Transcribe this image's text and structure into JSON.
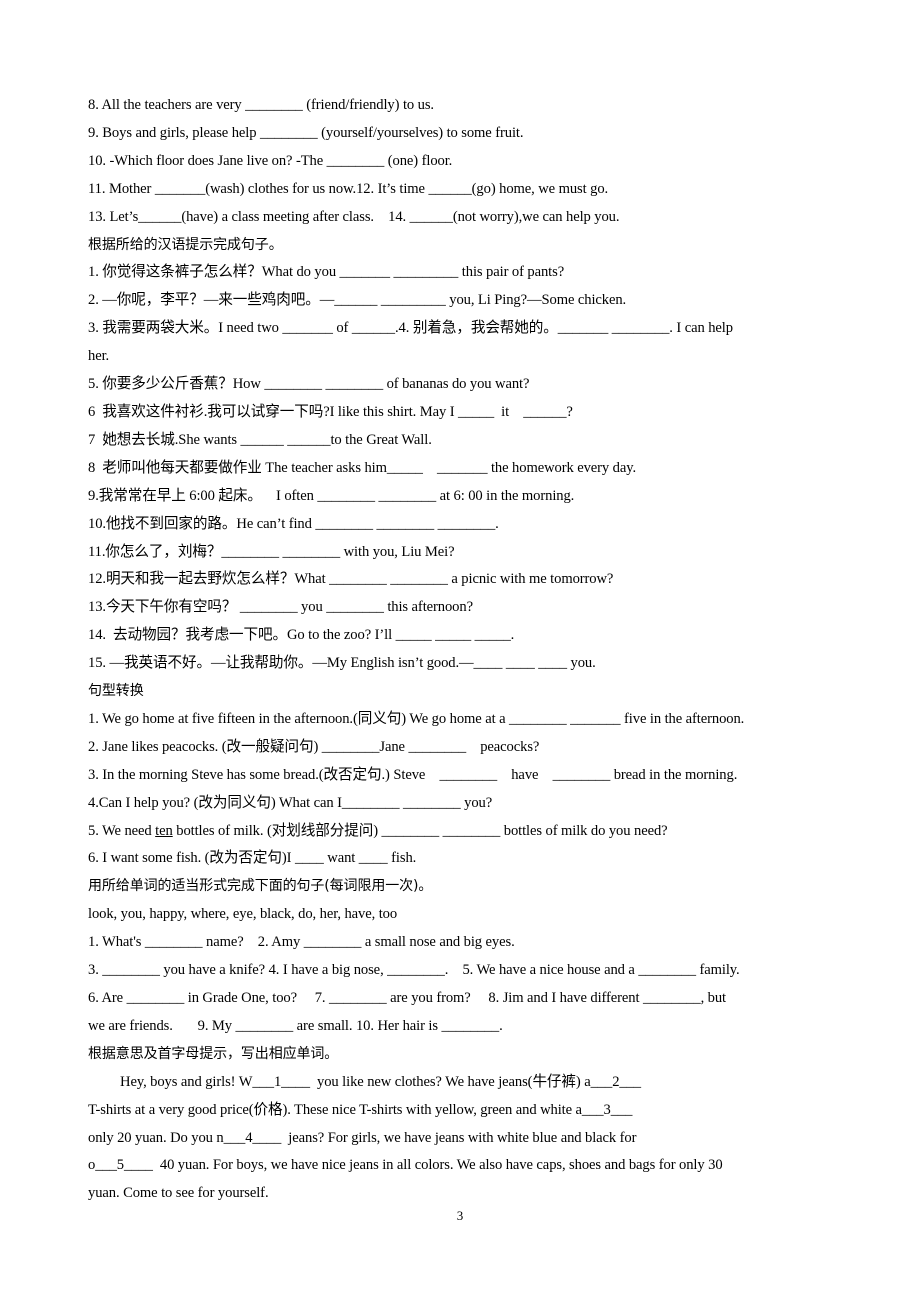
{
  "document": {
    "sections": [
      {
        "id": "fill-brackets-continued",
        "heading": null,
        "lines": [
          "8. All the teachers are very ________ (friend/friendly) to us.",
          "9. Boys and girls, please help ________ (yourself/yourselves) to some fruit.",
          "10. -Which floor does Jane live on? -The ________ (one) floor.",
          "11. Mother _______(wash) clothes for us now.12. It’s time ______(go) home, we must go.",
          "13. Let’s______(have) a class meeting after class.    14. ______(not worry),we can help you."
        ]
      },
      {
        "id": "chinese-hint-sentences",
        "heading": "根据所给的汉语提示完成句子。",
        "lines": [
          "1. 你觉得这条裤子怎么样？What do you _______ _________ this pair of pants?",
          "2. —你呢，李平？—来一些鸡肉吧。—______ _________ you, Li Ping?—Some chicken.",
          "3. 我需要两袋大米。I need two _______ of ______.4. 别着急，我会帮她的。_______ ________. I can help",
          "her.",
          "5. 你要多少公斤香蕉？How ________ ________ of bananas do you want?",
          "6  我喜欢这件衬衫.我可以试穿一下吗?I like this shirt. May I _____  it    ______?",
          "7  她想去长城.She wants ______ ______to the Great Wall.",
          "8  老师叫他每天都要做作业 The teacher asks him_____    _______ the homework every day.",
          "9.我常常在早上 6:00 起床。    I often ________ ________ at 6: 00 in the morning.",
          "10.他找不到回家的路。He can’t find ________ ________ ________.",
          "11.你怎么了，刘梅？________ ________ with you, Liu Mei?",
          "12.明天和我一起去野炊怎么样？What ________ ________ a picnic with me tomorrow?",
          "13.今天下午你有空吗？ ________ you ________ this afternoon?",
          "14.  去动物园？我考虑一下吧。Go to the zoo? I’ll _____ _____ _____.",
          "15. —我英语不好。—让我帮助你。—My English isn’t good.—____ ____ ____ you."
        ]
      },
      {
        "id": "sentence-transformation",
        "heading": "句型转换",
        "lines": [
          "1. We go home at five fifteen in the afternoon.(同义句) We go home at a ________ _______ five in the afternoon.",
          "2. Jane likes peacocks. (改一般疑问句) ________Jane ________    peacocks?",
          "3. In the morning Steve has some bread.(改否定句.) Steve    ________    have    ________ bread in the morning.",
          "4.Can I help you? (改为同义句) What can I________ ________ you?",
          "5. We need ten bottles of milk. (对划线部分提问) ________ ________ bottles of milk do you need?",
          "6. I want some fish. (改为否定句)I ____ want ____ fish."
        ],
        "underlined_word": "ten"
      },
      {
        "id": "word-form-fill",
        "heading": "用所给单词的适当形式完成下面的句子(每词限用一次)。",
        "word_bank": "look, you, happy, where, eye, black, do, her, have, too",
        "lines": [
          "1. What's ________ name?    2. Amy ________ a small nose and big eyes.",
          "3. ________ you have a knife? 4. I have a big nose, ________.    5. We have a nice house and a ________ family.",
          "6. Are ________ in Grade One, too?     7. ________ are you from?     8. Jim and I have different ________, but",
          "we are friends.       9. My ________ are small. 10. Her hair is ________."
        ]
      },
      {
        "id": "first-letter-cloze",
        "heading": "根据意思及首字母提示，写出相应单词。",
        "lines": [
          "Hey, boys and girls! W___1____  you like new clothes? We have jeans(牛仔裤) a___2___",
          "T-shirts at a very good price(价格). These nice T-shirts with yellow, green and white a___3___",
          "only 20 yuan. Do you n___4____  jeans? For girls, we have jeans with white blue and black for",
          "o___5____  40 yuan. For boys, we have nice jeans in all colors. We also have caps, shoes and bags for only 30",
          "yuan. Come to see for yourself."
        ]
      }
    ],
    "page_number": "3"
  }
}
